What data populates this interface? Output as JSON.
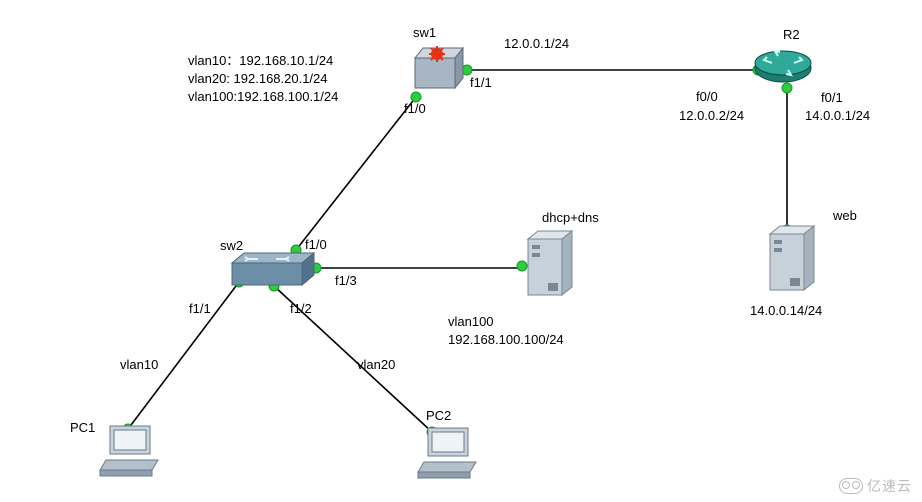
{
  "devices": {
    "sw1": {
      "name": "sw1"
    },
    "r2": {
      "name": "R2"
    },
    "sw2": {
      "name": "sw2"
    },
    "dhcp": {
      "name": "dhcp+dns",
      "ip_label": "vlan100",
      "ip": "192.168.100.100/24"
    },
    "web": {
      "name": "web",
      "ip": "14.0.0.14/24"
    },
    "pc1": {
      "name": "PC1"
    },
    "pc2": {
      "name": "PC2"
    }
  },
  "sw1_config": {
    "lines": [
      "vlan10：192.168.10.1/24",
      "vlan20: 192.168.20.1/24",
      "vlan100:192.168.100.1/24"
    ]
  },
  "labels": {
    "sw1_link_ip": "12.0.0.1/24",
    "r2_f00": "f0/0",
    "r2_f00_ip": "12.0.0.2/24",
    "r2_f01": "f0/1",
    "r2_f01_ip": "14.0.0.1/24",
    "sw1_f10": "f1/0",
    "sw1_f11": "f1/1",
    "sw2_f10": "f1/0",
    "sw2_f11": "f1/1",
    "sw2_f12": "f1/2",
    "sw2_f13": "f1/3",
    "vlan10": "vlan10",
    "vlan20": "vlan20"
  },
  "watermark": "亿速云"
}
